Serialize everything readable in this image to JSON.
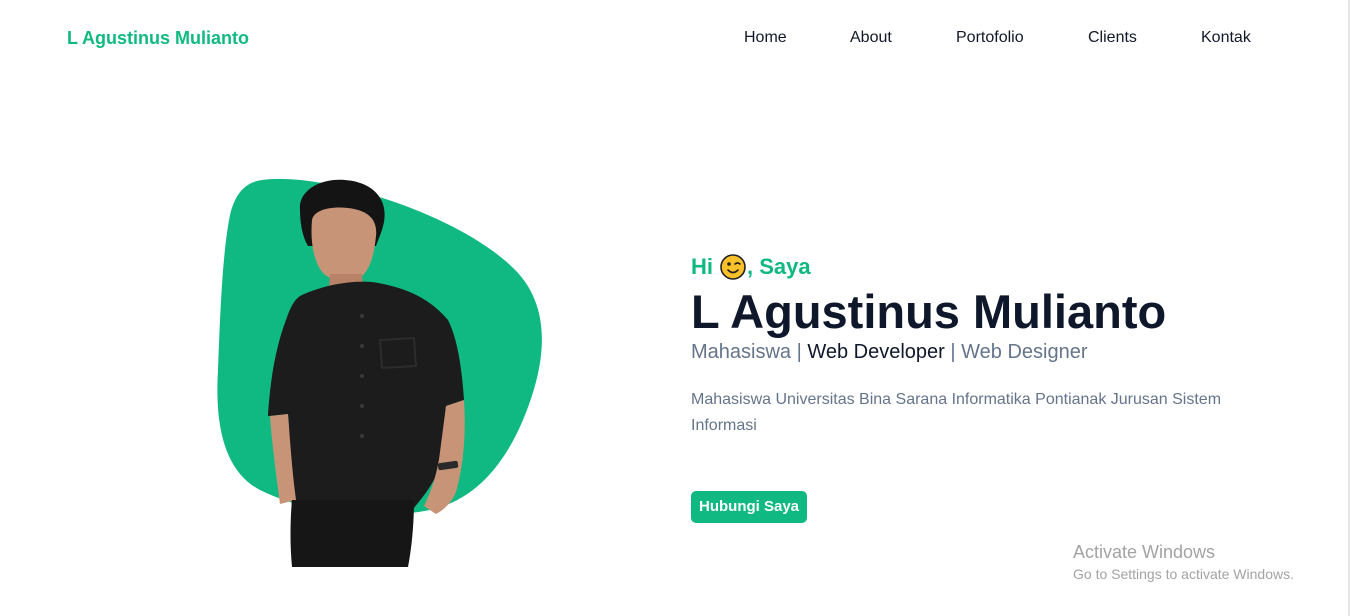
{
  "navbar": {
    "brand": "L Agustinus Mulianto",
    "links": [
      {
        "label": "Home"
      },
      {
        "label": "About"
      },
      {
        "label": "Portofolio"
      },
      {
        "label": "Clients"
      },
      {
        "label": "Kontak"
      }
    ]
  },
  "hero": {
    "greeting_prefix": "Hi",
    "greeting_emoji": "winking-face-icon",
    "greeting_suffix": ", Saya",
    "name": "L Agustinus Mulianto",
    "roles": {
      "role1": "Mahasiswa",
      "sep1": " | ",
      "role2": "Web Developer",
      "sep2": " | ",
      "role3": "Web Designer"
    },
    "description": "Mahasiswa Universitas Bina Sarana Informatika Pontianak Jurusan Sistem Informasi",
    "cta_label": "Hubungi Saya",
    "photo": "person-in-black-shirt-photo",
    "blob_color": "#10b981"
  },
  "watermark": {
    "title": "Activate Windows",
    "subtitle": "Go to Settings to activate Windows."
  },
  "colors": {
    "accent": "#10b981",
    "heading": "#0f172a",
    "muted": "#64748b"
  }
}
